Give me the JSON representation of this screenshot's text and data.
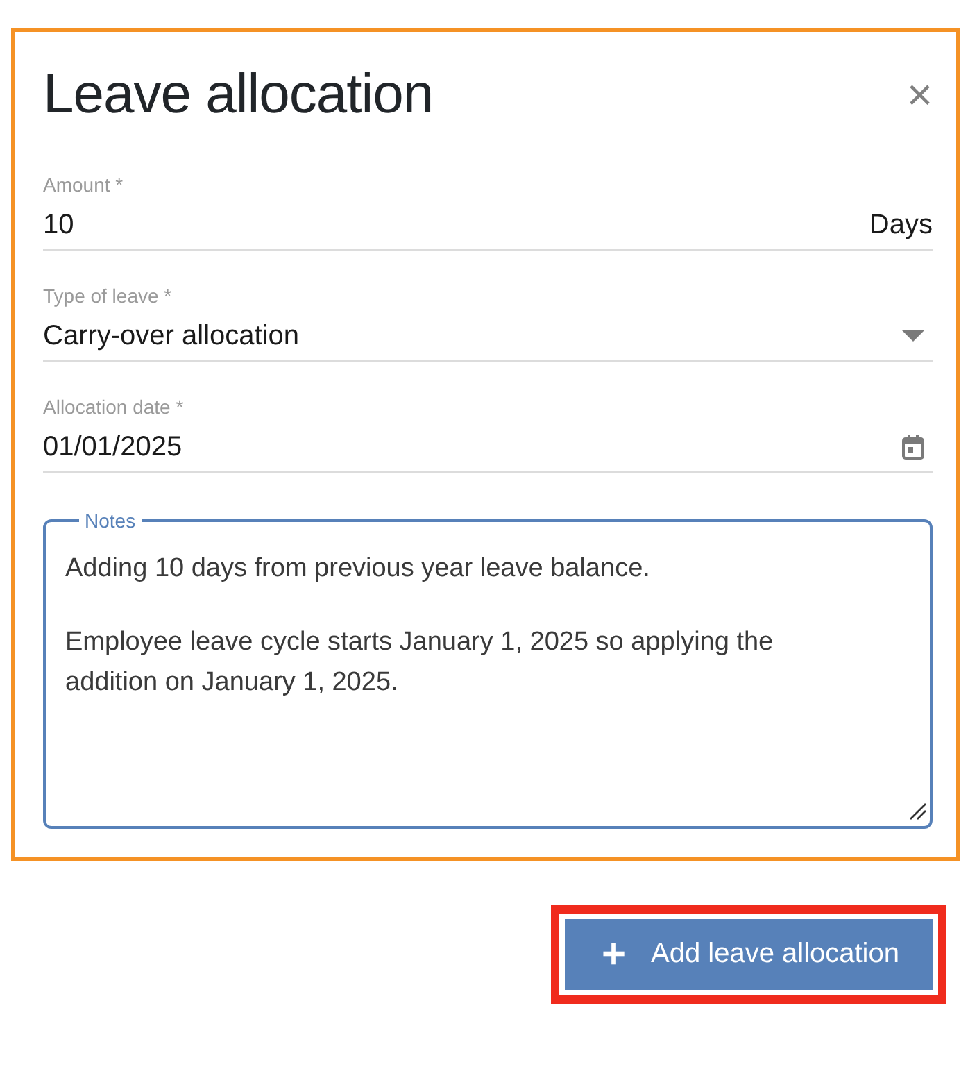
{
  "dialog": {
    "title": "Leave allocation",
    "close": "×"
  },
  "fields": [
    {
      "kind": "number",
      "label": "Amount *",
      "value": "10",
      "suffix": "Days"
    },
    {
      "kind": "select",
      "label": "Type of leave *",
      "value": "Carry-over allocation"
    },
    {
      "kind": "date",
      "label": "Allocation date *",
      "value": "01/01/2025"
    }
  ],
  "notes": {
    "label": "Notes",
    "focused": true,
    "paragraphs": [
      "Adding 10 days from previous year leave balance.",
      "Employee leave cycle starts January 1, 2025 so applying the addition on January 1, 2025."
    ]
  },
  "button": {
    "icon": "+",
    "label": "Add leave allocation"
  }
}
